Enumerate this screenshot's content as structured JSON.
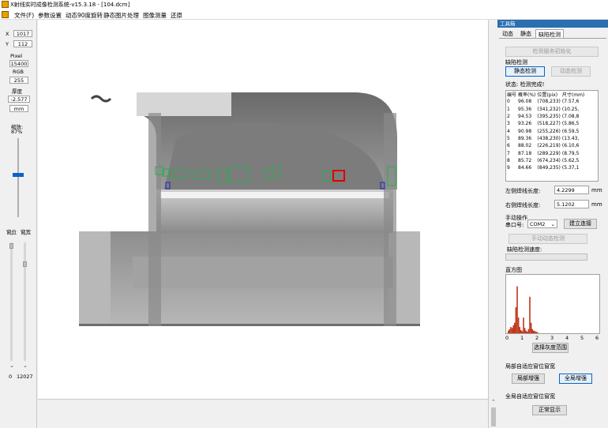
{
  "window": {
    "title": "X射线实时成像检测系统-v15.3.18 - [104.dcm]"
  },
  "menu": [
    "文件(F)",
    "参数设置",
    "动态90度旋转",
    "静态图片处理",
    "图像测量",
    "还原"
  ],
  "left_panel": {
    "x_label": "X",
    "x_value": "1017",
    "y_label": "Y",
    "y_value": "112",
    "pixel_label": "Pixel",
    "pixel_value": "15400",
    "rgb_label": "RGB",
    "rgb_value": "255",
    "thickness_label": "厚度",
    "thickness_value": "-2.577",
    "thickness_unit": "mm",
    "zoom_label": "缩放:",
    "zoom_value": "87%",
    "window_pos_label": "窗位",
    "window_width_label": "窗宽",
    "bottom_left_value": "0",
    "bottom_right_value": "12027"
  },
  "right_panel": {
    "title": "工具箱",
    "tabs": [
      "动态",
      "静态",
      "缺陷检测"
    ],
    "active_tab": "缺陷检测",
    "init_button": "检测服务初始化",
    "defect_group_label": "缺陷检测",
    "static_detect_button": "静态检测",
    "dynamic_detect_button": "动态检测",
    "status_text": "状态: 检测完成!",
    "table_headers": [
      "编号",
      "概率(%)",
      "位置(pix)",
      "尺寸(mm)"
    ],
    "table_rows": [
      [
        "0",
        "96.08",
        "(708,233)",
        "(7.57,6"
      ],
      [
        "1",
        "95.36",
        "(341,232)",
        "(10.25,"
      ],
      [
        "2",
        "94.53",
        "(395,235)",
        "(7.08,8"
      ],
      [
        "3",
        "93.26",
        "(518,227)",
        "(5.86,5"
      ],
      [
        "4",
        "90.98",
        "(255,226)",
        "(6.59,5"
      ],
      [
        "5",
        "89.36",
        "(438,230)",
        "(13.43,"
      ],
      [
        "6",
        "88.02",
        "(226,219)",
        "(6.10,6"
      ],
      [
        "7",
        "87.18",
        "(289,229)",
        "(8.79,5"
      ],
      [
        "8",
        "85.72",
        "(674,234)",
        "(5.62,5"
      ],
      [
        "9",
        "84.66",
        "(849,235)",
        "(5.37,1"
      ]
    ],
    "left_weld_label": "左侧焊线长度:",
    "left_weld_value": "4.2299",
    "left_weld_unit": "mm",
    "right_weld_label": "右侧焊线长度:",
    "right_weld_value": "5.1202",
    "right_weld_unit": "mm",
    "manual_label": "手动操作",
    "port_label": "串口号:",
    "port_value": "COM2",
    "connect_button": "建立连接",
    "manual_dynamic_button": "手动动态检测",
    "defect_speed_label": "缺陷检测速度:",
    "histogram_label": "直方图",
    "histogram_ticks": [
      "0",
      "1",
      "2",
      "3",
      "4",
      "5",
      "6"
    ],
    "histogram_bars": [
      0.05,
      0.08,
      0.12,
      0.1,
      0.15,
      0.2,
      0.5,
      0.9,
      0.3,
      0.12,
      0.06,
      0.04,
      0.3,
      0.1,
      0.05,
      0.03,
      0.08,
      0.7,
      0.2,
      0.08,
      0.05,
      0.04,
      0.03,
      0.02
    ],
    "gray_range_button": "选择灰度范围",
    "local_group_label": "局部自适应窗位窗宽",
    "local_enhance_button": "局部增强",
    "global_enhance_button": "全局增强",
    "global_group_label": "全局自适应窗位窗宽",
    "normal_display_button": "正常显示",
    "colors": {
      "accent": "#2a6fb0",
      "histogram": "#c0341a",
      "detect_box": "#22b14c",
      "detect_box_alt": "#2020c8",
      "detect_box_red": "#e00000"
    }
  }
}
